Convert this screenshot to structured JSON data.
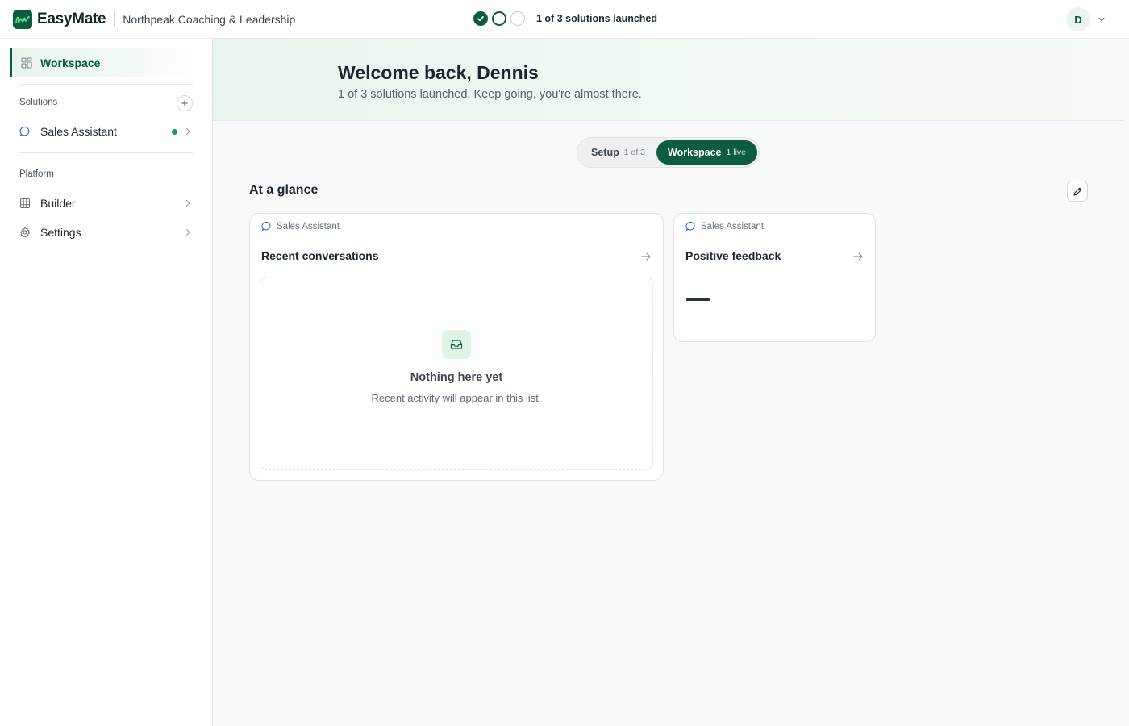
{
  "header": {
    "brand": "EasyMate",
    "org_name": "Northpeak Coaching & Leadership",
    "progress_text": "1 of 3 solutions launched",
    "progress_steps": [
      "done",
      "current",
      "todo"
    ],
    "avatar_initial": "D"
  },
  "sidebar": {
    "active_item": "Workspace",
    "solutions_title": "Solutions",
    "solutions": [
      {
        "label": "Sales Assistant",
        "status": "live"
      }
    ],
    "platform_title": "Platform",
    "platform_items": [
      {
        "label": "Builder",
        "icon": "grid-icon"
      },
      {
        "label": "Settings",
        "icon": "gear-icon"
      }
    ]
  },
  "hero": {
    "title": "Welcome back, Dennis",
    "subtitle": "1 of 3 solutions launched. Keep going, you're almost there."
  },
  "segmented": {
    "setup_label": "Setup",
    "setup_meta": "1 of 3",
    "workspace_label": "Workspace",
    "workspace_meta": "1 live",
    "selected": "Workspace"
  },
  "glance": {
    "title": "At a glance",
    "cards": [
      {
        "source": "Sales Assistant",
        "title": "Recent conversations",
        "empty_title": "Nothing here yet",
        "empty_subtitle": "Recent activity will appear in this list."
      },
      {
        "source": "Sales Assistant",
        "title": "Positive feedback",
        "value": "—"
      }
    ]
  },
  "colors": {
    "accent": "#0d5c3f",
    "live": "#1f9d55"
  }
}
